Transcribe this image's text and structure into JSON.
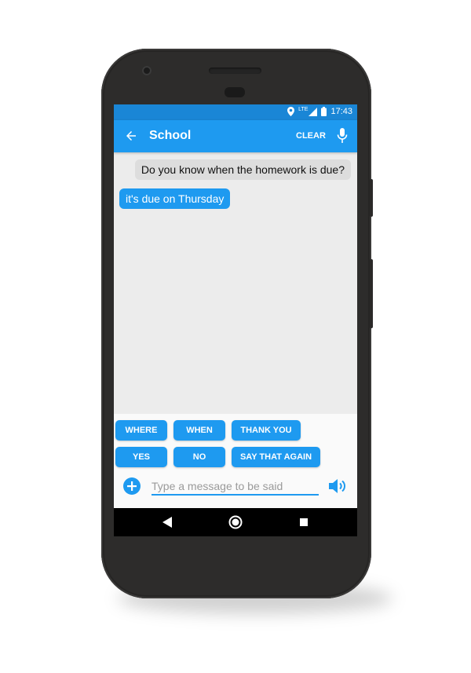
{
  "status_bar": {
    "time": "17:43",
    "network": "LTE",
    "icons": [
      "location-icon",
      "signal-icon",
      "battery-icon"
    ]
  },
  "app_bar": {
    "back_icon": "arrow-left-icon",
    "title": "School",
    "clear_label": "CLEAR",
    "mic_icon": "microphone-icon"
  },
  "messages": [
    {
      "side": "incoming",
      "text": "Do you know when the homework is due?"
    },
    {
      "side": "outgoing",
      "text": "it's due on Thursday"
    }
  ],
  "quick_replies": [
    "WHERE",
    "WHEN",
    "THANK YOU",
    "YES",
    "NO",
    "SAY THAT AGAIN"
  ],
  "composer": {
    "add_icon": "plus-circle-icon",
    "placeholder": "Type a message to be said",
    "value": "",
    "speak_icon": "speaker-icon"
  },
  "nav_bar": {
    "icons": [
      "back-triangle-icon",
      "home-circle-icon",
      "recents-square-icon"
    ]
  },
  "colors": {
    "accent": "#1e9af0",
    "status_bar": "#1a86d6",
    "incoming_bubble": "#dddddd",
    "chat_background": "#ececec",
    "phone_body": "#2d2c2b"
  }
}
